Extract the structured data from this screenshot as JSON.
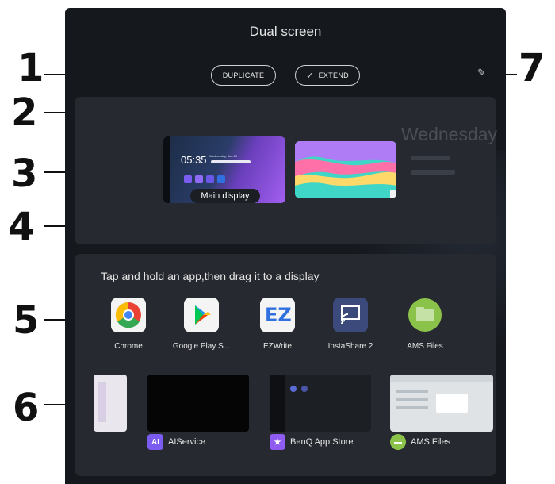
{
  "callouts": [
    "1",
    "2",
    "3",
    "4",
    "5",
    "6",
    "7"
  ],
  "panel": {
    "title": "Dual screen",
    "buttons": {
      "duplicate": "DUPLICATE",
      "extend": "EXTEND"
    },
    "icons": {
      "check": "check-icon",
      "pencil": "pencil-icon"
    }
  },
  "displays": {
    "main_label": "Main display",
    "main_clock": "05:35",
    "main_date": "Wednesday, Jun 19",
    "background_day": "Wednesday"
  },
  "apps_section": {
    "hint": "Tap and hold an app,then drag it to a display",
    "apps": [
      {
        "label": "Chrome",
        "icon": "chrome-icon"
      },
      {
        "label": "Google Play S...",
        "icon": "google-play-icon"
      },
      {
        "label": "EZWrite",
        "icon": "ezwrite-icon"
      },
      {
        "label": "InstaShare 2",
        "icon": "instashare-icon"
      },
      {
        "label": "AMS Files",
        "icon": "folder-icon"
      }
    ]
  },
  "recent_apps": [
    {
      "label": "AIService",
      "icon": "ai-icon"
    },
    {
      "label": "BenQ App Store",
      "icon": "store-icon"
    },
    {
      "label": "AMS Files",
      "icon": "folder-icon"
    }
  ],
  "colors": {
    "panel_bg": "#15181d",
    "section_bg": "#26292f",
    "accent_purple": "#7b5cf0",
    "accent_blue": "#2f6fe0"
  }
}
